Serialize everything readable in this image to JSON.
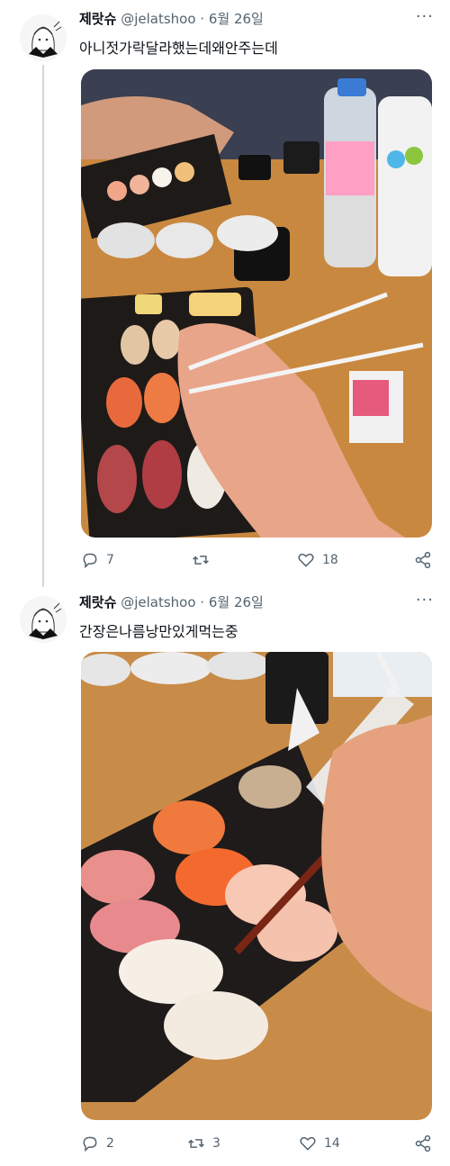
{
  "tweets": [
    {
      "author_name": "제랏슈",
      "handle": "@jelatshoo",
      "separator": "·",
      "date": "6월 26일",
      "text": "아니젓가락달라했는데왜안주는데",
      "more_label": "···",
      "replies": "7",
      "retweets": "",
      "likes": "18",
      "photo_icon": "sushi-with-syringe-chopsticks-photo"
    },
    {
      "author_name": "제랏슈",
      "handle": "@jelatshoo",
      "separator": "·",
      "date": "6월 26일",
      "text": "간장은나름낭만있게먹는중",
      "more_label": "···",
      "replies": "2",
      "retweets": "3",
      "likes": "14",
      "photo_icon": "syringe-soy-sauce-on-sushi-photo"
    }
  ],
  "colors": {
    "text_primary": "#0f1419",
    "text_secondary": "#536471",
    "thread_line": "#cfd9de",
    "table_wood": "#c9883f",
    "sushi_tray": "#1e1a18"
  }
}
